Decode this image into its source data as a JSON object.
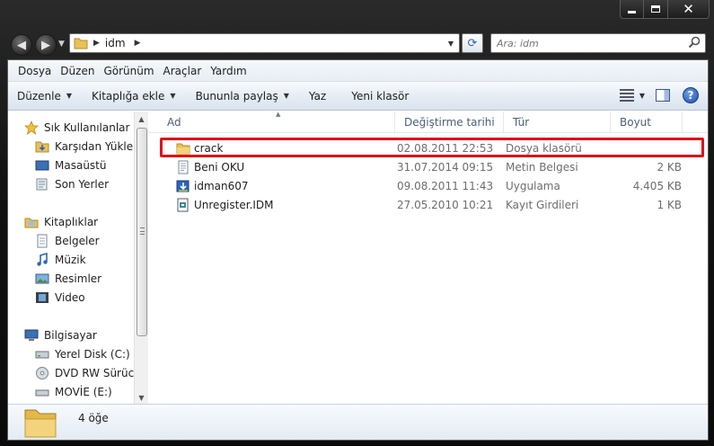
{
  "address": {
    "crumbs": [
      "idm"
    ]
  },
  "search": {
    "placeholder": "Ara: idm"
  },
  "menu": [
    "Dosya",
    "Düzen",
    "Görünüm",
    "Araçlar",
    "Yardım"
  ],
  "toolbar": {
    "organize": "Düzenle",
    "library": "Kitaplığa ekle",
    "share": "Bununla paylaş",
    "burn": "Yaz",
    "new_folder": "Yeni klasör"
  },
  "nav": {
    "favorites": "Sık Kullanılanlar",
    "downloads": "Karşıdan Yüklem",
    "desktop": "Masaüstü",
    "recent": "Son Yerler",
    "libraries": "Kitaplıklar",
    "documents": "Belgeler",
    "music": "Müzik",
    "pictures": "Resimler",
    "videos": "Video",
    "computer": "Bilgisayar",
    "localdisk": "Yerel Disk (C:)",
    "dvd": "DVD RW Sürücüs",
    "movie": "MOVİE (E:)"
  },
  "columns": {
    "name": "Ad",
    "date": "Değiştirme tarihi",
    "type": "Tür",
    "size": "Boyut"
  },
  "files": [
    {
      "name": "crack",
      "date": "02.08.2011 22:53",
      "type": "Dosya klasörü",
      "size": "",
      "icon": "folder-icon"
    },
    {
      "name": "Beni OKU",
      "date": "31.07.2014 09:15",
      "type": "Metin Belgesi",
      "size": "2 KB",
      "icon": "text-document-icon"
    },
    {
      "name": "idman607",
      "date": "09.08.2011 11:43",
      "type": "Uygulama",
      "size": "4.405 KB",
      "icon": "installer-icon"
    },
    {
      "name": "Unregister.IDM",
      "date": "27.05.2010 10:21",
      "type": "Kayıt Girdileri",
      "size": "1 KB",
      "icon": "registry-icon"
    }
  ],
  "status": {
    "count": "4 öğe"
  },
  "colors": {
    "highlight": "#e0101a",
    "accent": "#2f63b5"
  }
}
